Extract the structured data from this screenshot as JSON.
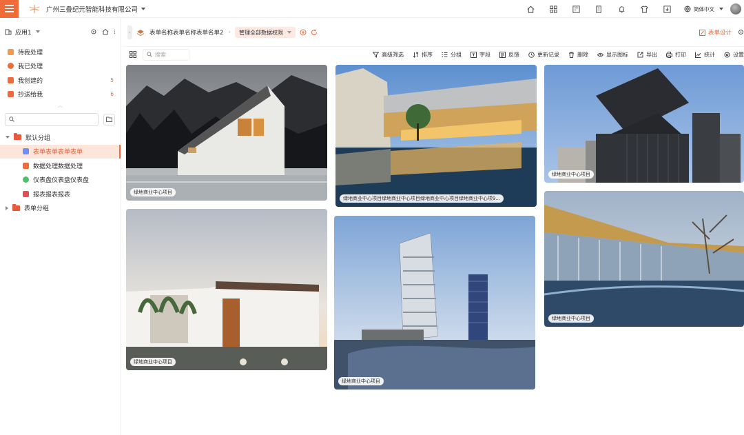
{
  "header": {
    "company": "广州三叠纪元智能科技有限公司",
    "language": "简体中文",
    "icons": [
      "home-icon",
      "apps-icon",
      "card-icon",
      "document-icon",
      "bell-icon",
      "shirt-icon",
      "download-icon",
      "globe-icon"
    ]
  },
  "sidebar": {
    "app_label": "应用1",
    "quick": [
      {
        "label": "待我处理",
        "badge": "",
        "color": "#f39a4f"
      },
      {
        "label": "我已处理",
        "badge": "",
        "color": "#f06b3a"
      },
      {
        "label": "我创建的",
        "badge": "5",
        "color": "#f06b3a"
      },
      {
        "label": "抄送给我",
        "badge": "6",
        "color": "#f06b3a"
      }
    ],
    "search_placeholder": "",
    "groups": [
      {
        "label": "默认分组",
        "children": [
          {
            "label": "表单表单表单表单",
            "color": "#6f8ff7",
            "active": true
          },
          {
            "label": "数据处理数据处理",
            "color": "#f06b3a",
            "active": false
          },
          {
            "label": "仪表盘仪表盘仪表盘",
            "color": "#4fbf6b",
            "active": false
          },
          {
            "label": "报表报表报表",
            "color": "#ea4d4d",
            "active": false
          }
        ]
      },
      {
        "label": "表单分组",
        "children": []
      }
    ]
  },
  "main": {
    "crumb_title": "表单名称表单名称表单名单2",
    "permission": "管理全部数据权限",
    "design_label": "表单设计",
    "search_placeholder": "搜索",
    "actions": [
      {
        "label": "高级筛选",
        "icon": "filter-icon"
      },
      {
        "label": "排序",
        "icon": "sort-icon"
      },
      {
        "label": "分组",
        "icon": "group-icon"
      },
      {
        "label": "字段",
        "icon": "field-icon"
      },
      {
        "label": "反馈",
        "icon": "feedback-icon"
      },
      {
        "label": "更新记录",
        "icon": "history-icon"
      },
      {
        "label": "删除",
        "icon": "trash-icon"
      },
      {
        "label": "显示图标",
        "icon": "eye-icon"
      },
      {
        "label": "导出",
        "icon": "export-icon"
      },
      {
        "label": "打印",
        "icon": "printer-icon"
      },
      {
        "label": "统计",
        "icon": "chart-icon"
      },
      {
        "label": "设置",
        "icon": "gear-icon"
      }
    ],
    "cards": [
      {
        "caption": "绿地商业中心项目",
        "scene": "mountain-house"
      },
      {
        "caption": "绿地商业中心项目绿地商业中心项目绿地商业中心项目绿地商业中心项9...",
        "scene": "pool-terrace"
      },
      {
        "caption": "绿地商业中心项目",
        "scene": "dark-tower"
      },
      {
        "caption": "绿地商业中心项目",
        "scene": "villa"
      },
      {
        "caption": "绿地商业中心项目",
        "scene": "twin-towers"
      },
      {
        "caption": "绿地商业中心项目",
        "scene": "canopy-pool"
      }
    ]
  }
}
